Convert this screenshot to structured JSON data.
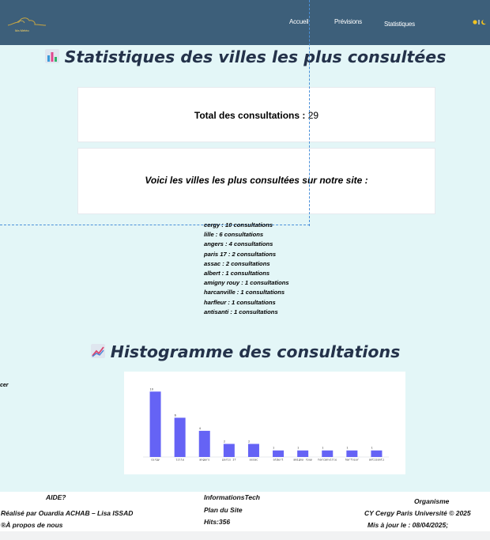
{
  "header": {
    "logo_text": "Ma Météo",
    "nav": [
      "Accueil",
      "Prévisions",
      "Statistiques"
    ]
  },
  "stats": {
    "title": "Statistiques des villes les plus consultées",
    "total_label": "Total des consultations :",
    "total_value": "29",
    "intro": "Voici les villes les plus consultées sur notre site :",
    "cities": [
      "cergy : 10 consultations",
      "lille : 6 consultations",
      "angers : 4 consultations",
      "paris 17 : 2 consultations",
      "assac : 2 consultations",
      "albert : 1 consultations",
      "amigny rouy : 1 consultations",
      "harcanville : 1 consultations",
      "harfleur : 1 consultations",
      "antisanti : 1 consultations"
    ]
  },
  "histogram": {
    "title": "Histogramme des consultations",
    "side_text": "cer"
  },
  "chart_data": {
    "type": "bar",
    "categories": [
      "cergy",
      "lille",
      "angers",
      "paris 17",
      "assac",
      "albert",
      "amigny rouy",
      "harcanville",
      "harfleur",
      "antisanti"
    ],
    "values": [
      10,
      6,
      4,
      2,
      2,
      1,
      1,
      1,
      1,
      1
    ],
    "ylim": [
      0,
      11
    ],
    "color": "#6563f5",
    "grid": false
  },
  "footer": {
    "help": "AIDE?",
    "credits": "Réalisé par Ouardia ACHAB – Lisa ISSAD",
    "about": "À propos de nous",
    "about_glyph": "®",
    "info": "InformationsTech",
    "sitemap": "Plan du Site",
    "hits": "Hits:356",
    "org": "Organisme",
    "university": "CY Cergy Paris Université © 2025",
    "updated": "Mis à jour le : 08/04/2025;"
  },
  "colors": {
    "header_bg": "#3d5f7a",
    "page_bg": "#e3f6f7",
    "bar": "#6563f5",
    "title": "#24324a"
  }
}
